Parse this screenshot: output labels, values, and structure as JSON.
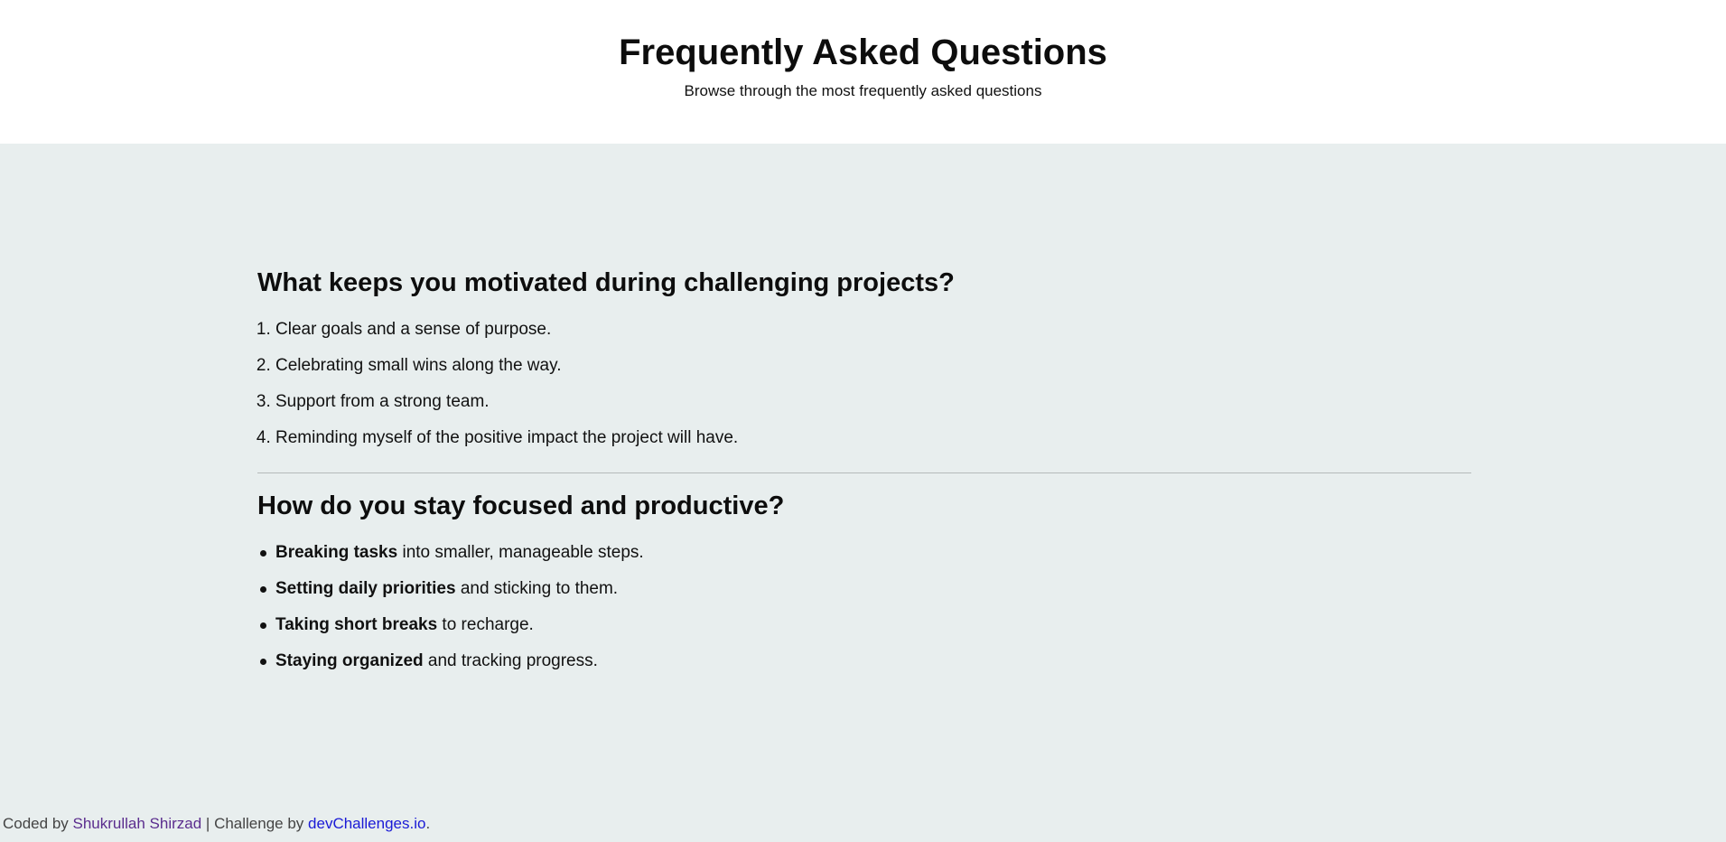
{
  "header": {
    "title": "Frequently Asked Questions",
    "subtitle": "Browse through the most frequently asked questions"
  },
  "faqs": [
    {
      "question": "What keeps you motivated during challenging projects?",
      "answers": [
        "Clear goals and a sense of purpose.",
        "Celebrating small wins along the way.",
        "Support from a strong team.",
        "Reminding myself of the positive impact the project will have."
      ]
    },
    {
      "question": "How do you stay focused and productive?",
      "answers": [
        {
          "bold": "Breaking tasks",
          "rest": " into smaller, manageable steps."
        },
        {
          "bold": "Setting daily priorities",
          "rest": " and sticking to them."
        },
        {
          "bold": "Taking short breaks",
          "rest": " to recharge."
        },
        {
          "bold": "Staying organized",
          "rest": " and tracking progress."
        }
      ]
    }
  ],
  "footer": {
    "prefix": "Coded by ",
    "author": "Shukrullah Shirzad",
    "middle": " | Challenge by ",
    "site": "devChallenges.io",
    "suffix": "."
  },
  "colors": {
    "page_bg": "#e8eeee",
    "header_bg": "#ffffff",
    "author_link": "#5b2d8e",
    "site_link": "#1a1ad6"
  }
}
